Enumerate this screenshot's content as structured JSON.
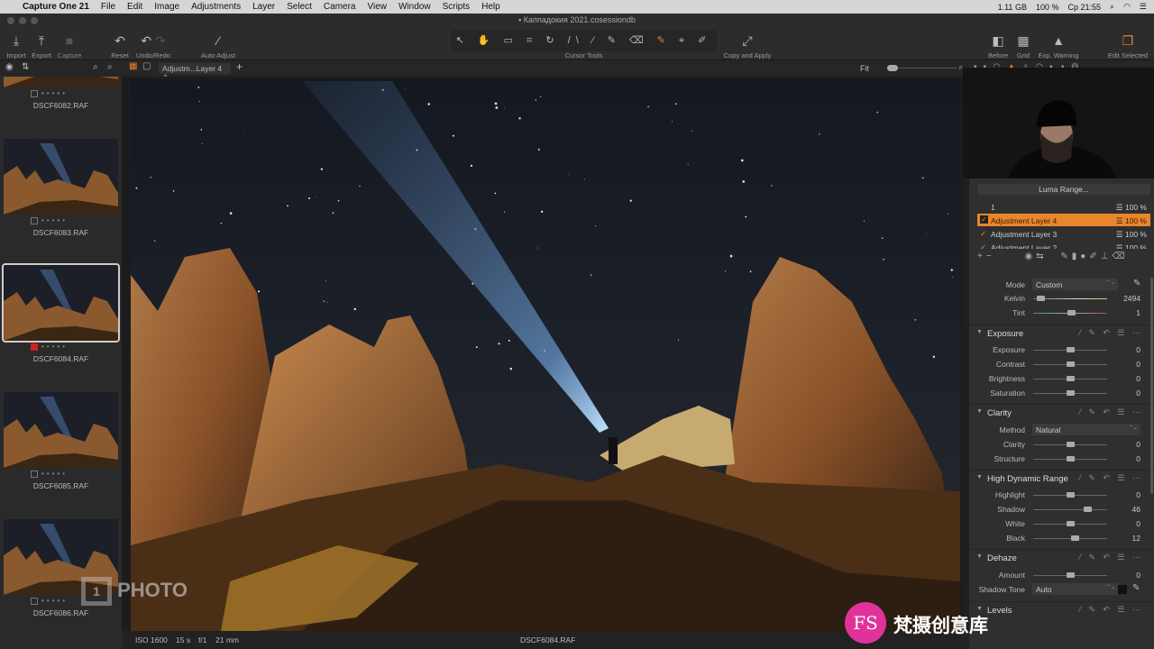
{
  "menubar": {
    "apple": "",
    "app": "Capture One 21",
    "items": [
      "File",
      "Edit",
      "Image",
      "Adjustments",
      "Layer",
      "Select",
      "Camera",
      "View",
      "Window",
      "Scripts",
      "Help"
    ],
    "status": {
      "memory": "1.11 GB",
      "battery": "100 %",
      "clock": "Ср 21:55"
    }
  },
  "window_title": "Каппадокия 2021.cosessiondb",
  "toolbar": {
    "import": "Import",
    "export": "Export",
    "capture": "Capture",
    "reset": "Reset",
    "undo_redo": "Undo/Redo",
    "auto_adjust": "Auto Adjust",
    "cursor_tools": "Cursor Tools",
    "copy_apply": "Copy and Apply",
    "before": "Before",
    "grid": "Grid",
    "exp_warning": "Exp. Warning",
    "edit_selected": "Edit Selected"
  },
  "subbar": {
    "layer_select": "Adjustm...Layer 4",
    "zoom": "Fit"
  },
  "filmstrip": [
    {
      "name": "DSCF6082.RAF",
      "selected": false,
      "color_tag": ""
    },
    {
      "name": "DSCF6083.RAF",
      "selected": false,
      "color_tag": ""
    },
    {
      "name": "DSCF6084.RAF",
      "selected": true,
      "color_tag": "#d42020"
    },
    {
      "name": "DSCF6085.RAF",
      "selected": false,
      "color_tag": ""
    },
    {
      "name": "DSCF6086.RAF",
      "selected": false,
      "color_tag": ""
    }
  ],
  "infobar": {
    "iso": "ISO 1600",
    "shutter": "15 s",
    "aperture": "f/1",
    "focal": "21 mm",
    "filename": "DSCF6084.RAF"
  },
  "layers": {
    "luma_button": "Luma Range...",
    "items": [
      {
        "name": "1",
        "opacity": "100 %",
        "active": false,
        "checked": false
      },
      {
        "name": "Adjustment Layer 4",
        "opacity": "100 %",
        "active": true,
        "checked": true
      },
      {
        "name": "Adjustment Layer 3",
        "opacity": "100 %",
        "active": false,
        "checked": true
      },
      {
        "name": "Adjustment Layer 2",
        "opacity": "100 %",
        "active": false,
        "checked": true
      }
    ]
  },
  "white_balance": {
    "mode_label": "Mode",
    "mode": "Custom",
    "kelvin_label": "Kelvin",
    "kelvin": "2494",
    "tint_label": "Tint",
    "tint": "1"
  },
  "exposure": {
    "title": "Exposure",
    "sliders": [
      {
        "label": "Exposure",
        "value": "0"
      },
      {
        "label": "Contrast",
        "value": "0"
      },
      {
        "label": "Brightness",
        "value": "0"
      },
      {
        "label": "Saturation",
        "value": "0"
      }
    ]
  },
  "clarity": {
    "title": "Clarity",
    "method_label": "Method",
    "method": "Natural",
    "sliders": [
      {
        "label": "Clarity",
        "value": "0"
      },
      {
        "label": "Structure",
        "value": "0"
      }
    ]
  },
  "hdr": {
    "title": "High Dynamic Range",
    "sliders": [
      {
        "label": "Highlight",
        "value": "0"
      },
      {
        "label": "Shadow",
        "value": "46"
      },
      {
        "label": "White",
        "value": "0"
      },
      {
        "label": "Black",
        "value": "12"
      }
    ]
  },
  "dehaze": {
    "title": "Dehaze",
    "amount_label": "Amount",
    "amount": "0",
    "shadow_tone_label": "Shadow Tone",
    "shadow_tone": "Auto"
  },
  "levels": {
    "title": "Levels"
  },
  "watermarks": {
    "photo": "PHOTO",
    "photo_num": "1",
    "brand": "梵摄创意库",
    "brand_logo": "FS"
  },
  "colors": {
    "accent": "#e8862c",
    "panel": "#2f2f2f",
    "toolbar": "#2c2c2c"
  }
}
